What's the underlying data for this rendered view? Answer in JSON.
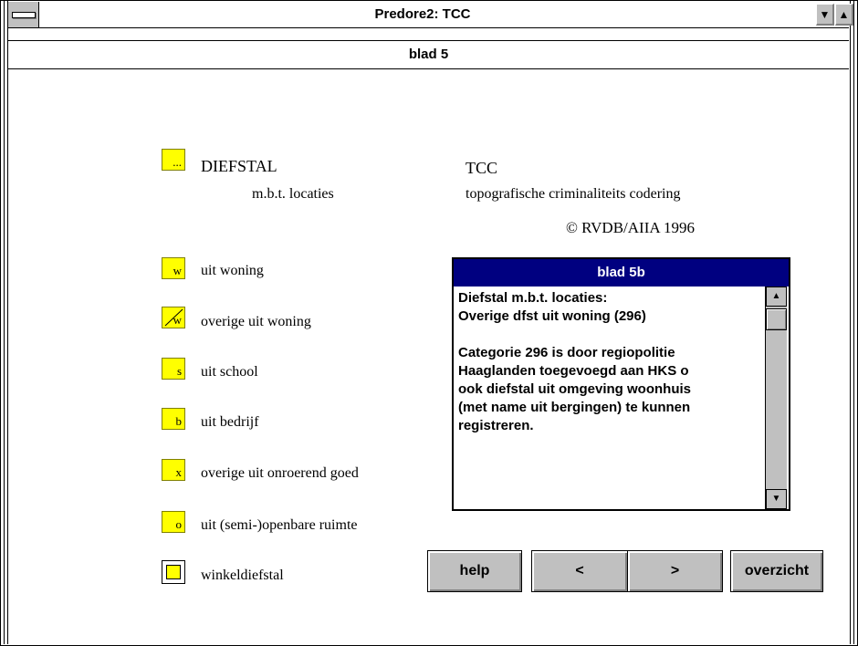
{
  "window": {
    "title": "Predore2: TCC",
    "menu_icon": "system-menu-icon",
    "minimize_glyph": "▼",
    "maximize_glyph": "▲"
  },
  "page": {
    "title": "blad 5"
  },
  "header": {
    "box_glyph": "...",
    "heading": "DIEFSTAL",
    "subheading": "m.b.t. locaties",
    "tcc_title": "TCC",
    "tcc_subtitle": "topografische criminaliteits codering",
    "copyright": "© RVDB/AIIA 1996"
  },
  "categories": [
    {
      "code": "w",
      "label": "uit woning"
    },
    {
      "code": "w",
      "label": "overige uit woning"
    },
    {
      "code": "s",
      "label": "uit school"
    },
    {
      "code": "b",
      "label": "uit bedrijf"
    },
    {
      "code": "x",
      "label": "overige uit onroerend goed"
    },
    {
      "code": "o",
      "label": "uit (semi-)openbare ruimte"
    },
    {
      "code": "",
      "label": "winkeldiefstal"
    }
  ],
  "subwindow": {
    "title": "blad 5b",
    "text": "Diefstal m.b.t. locaties:\nOverige dfst uit woning (296)\n\nCategorie 296 is door regiopolitie\nHaaglanden toegevoegd aan HKS o\nook diefstal uit omgeving woonhuis\n(met name uit bergingen) te kunnen\nregistreren.",
    "scroll_up": "▲",
    "scroll_down": "▼"
  },
  "buttons": {
    "help": "help",
    "prev": "<",
    "next": ">",
    "overview": "overzicht"
  },
  "colors": {
    "code_box": "#ffff00",
    "subwindow_title": "#000080",
    "button_face": "#c0c0c0"
  }
}
